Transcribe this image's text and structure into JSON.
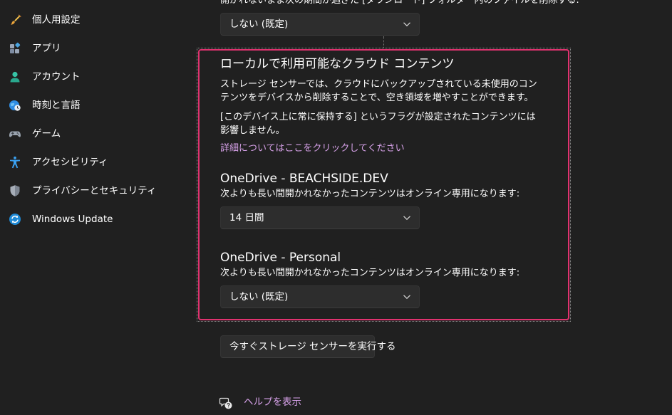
{
  "sidebar": {
    "items": [
      {
        "label": "個人用設定",
        "icon": "paintbrush-icon"
      },
      {
        "label": "アプリ",
        "icon": "apps-icon"
      },
      {
        "label": "アカウント",
        "icon": "person-icon"
      },
      {
        "label": "時刻と言語",
        "icon": "globe-clock-icon"
      },
      {
        "label": "ゲーム",
        "icon": "gamepad-icon"
      },
      {
        "label": "アクセシビリティ",
        "icon": "accessibility-icon"
      },
      {
        "label": "プライバシーとセキュリティ",
        "icon": "shield-icon"
      },
      {
        "label": "Windows Update",
        "icon": "windows-update-icon"
      }
    ]
  },
  "main": {
    "downloads_question": "開かれないまま次の期間が過ぎた [ダウンロード] フォルダー内のファイルを削除する:",
    "downloads_dropdown_value": "しない (既定)",
    "cloud_section": {
      "title": "ローカルで利用可能なクラウド コンテンツ",
      "description_1": "ストレージ センサーでは、クラウドにバックアップされている未使用のコンテンツをデバイスから削除することで、空き領域を増やすことができます。",
      "description_2": "[このデバイス上に常に保持する] というフラグが設定されたコンテンツには影響しません。",
      "link": "詳細についてはここをクリックしてください",
      "onedrive_accounts": [
        {
          "title": "OneDrive - BEACHSIDE.DEV",
          "description": "次よりも長い間開かれなかったコンテンツはオンライン専用になります:",
          "dropdown_value": "14 日間"
        },
        {
          "title": "OneDrive - Personal",
          "description": "次よりも長い間開かれなかったコンテンツはオンライン専用になります:",
          "dropdown_value": "しない (既定)"
        }
      ]
    },
    "run_button_label": "今すぐストレージ センサーを実行する",
    "help_link": "ヘルプを表示",
    "colors": {
      "background": "#202020",
      "control": "#2d2d2d",
      "focus_border": "#e0326f",
      "link": "#d6a1e8"
    }
  }
}
